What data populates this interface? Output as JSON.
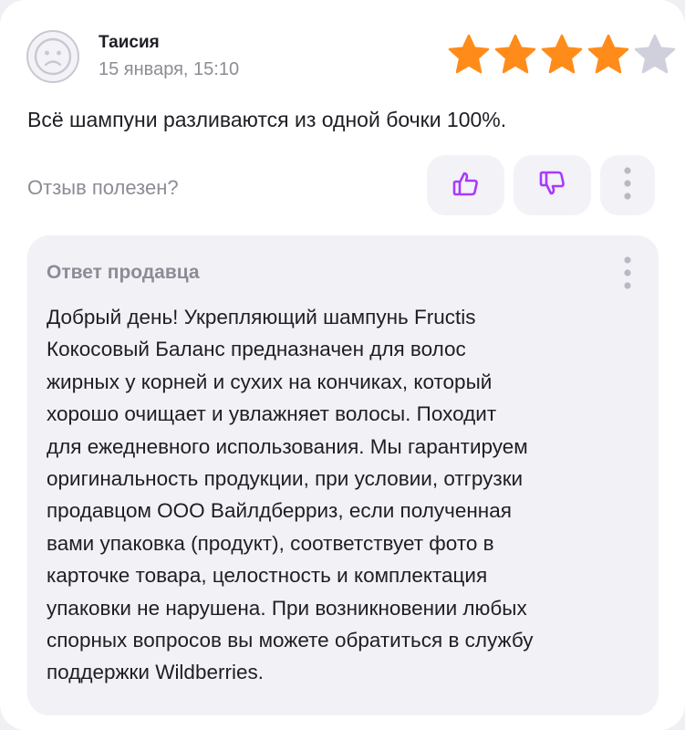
{
  "review": {
    "author": "Таисия",
    "date": "15 января, 15:10",
    "rating": 4,
    "rating_max": 5,
    "text": "Всё шампуни разливаются из одной бочки 100%.",
    "helpful_label": "Отзыв полезен?",
    "avatar_icon": "user-avatar-icon"
  },
  "actions": {
    "like_icon": "thumbs-up-icon",
    "dislike_icon": "thumbs-down-icon",
    "more_icon": "vertical-dots-icon"
  },
  "seller_reply": {
    "label": "Ответ продавца",
    "lines": [
      "Добрый день! Укрепляющий шампунь Fructis",
      "Кокосовый Баланс предназначен для волос",
      "жирных у корней и сухих на кончиках, который",
      "хорошо очищает и увлажняет волосы. Походит",
      "для ежедневного использования. Мы гарантируем",
      "оригинальность продукции, при условии, отгрузки",
      "продавцом ООО Вайлдберриз, если полученная",
      "вами упаковка (продукт), соответствует фото в",
      "карточке товара, целостность и комплектация",
      "упаковки не нарушена. При возникновении любых",
      "спорных вопросов вы можете обратиться в службу",
      "поддержки Wildberries."
    ]
  },
  "colors": {
    "star_filled": "#ff8c1a",
    "star_empty": "#cfd0db",
    "accent_purple": "#a73afd",
    "muted_text": "#8d8c96"
  }
}
